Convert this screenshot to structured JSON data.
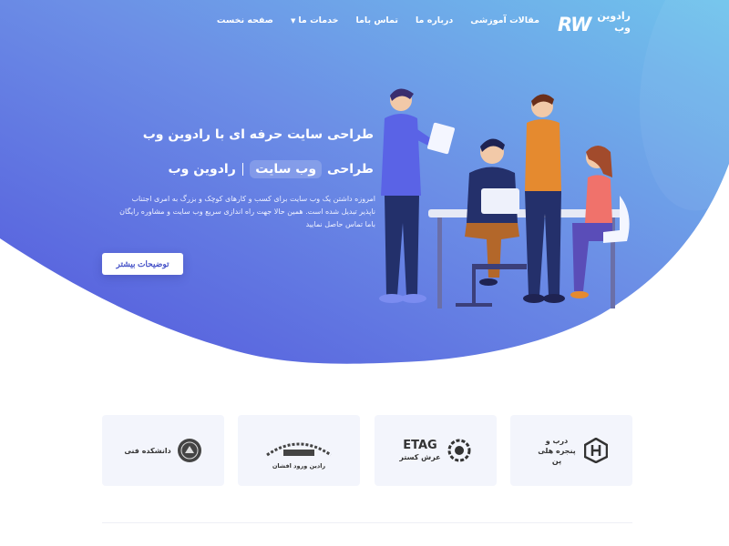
{
  "brand": {
    "logo_mark": "RW",
    "logo_text_line1": "رادوین",
    "logo_text_line2": "وب"
  },
  "nav": {
    "items": [
      {
        "label": "صفحه نخست"
      },
      {
        "label": "خدمات ما",
        "has_dropdown": true
      },
      {
        "label": "تماس باما"
      },
      {
        "label": "درباره ما"
      },
      {
        "label": "مقالات آموزشی"
      }
    ]
  },
  "hero": {
    "headline": "طراحی سایت حرفه ای با رادوین وب",
    "subhead_prefix": "طراحی",
    "subhead_highlight": "وب سایت",
    "subhead_suffix": "رادوین وب",
    "description": "امروزه داشتن یک وب سایت برای کسب و کارهای کوچک و بزرگ به امری اجتناب ناپذیر تبدیل شده است. همین حالا جهت راه اندازی سریع وب سایت و مشاوره رایگان باما تماس حاصل نمایید",
    "cta_label": "توضیحات بیشتر"
  },
  "colors": {
    "gradient_start": "#5a5fe0",
    "gradient_mid": "#6b8ee8",
    "gradient_end": "#6fc3ea",
    "accent": "#4a56c9",
    "card_bg": "#f3f5fc"
  },
  "partners": [
    {
      "name": "درب و پنجره هلی پن",
      "icon": "hexagon-h-logo-icon"
    },
    {
      "name": "ETAG",
      "subtitle": "عرش کستر",
      "icon": "gear-e-logo-icon"
    },
    {
      "name": "رادین ورود افشان",
      "icon": "gear-ring-logo-icon"
    },
    {
      "name": "دانشکده فنی",
      "icon": "university-seal-icon"
    }
  ]
}
